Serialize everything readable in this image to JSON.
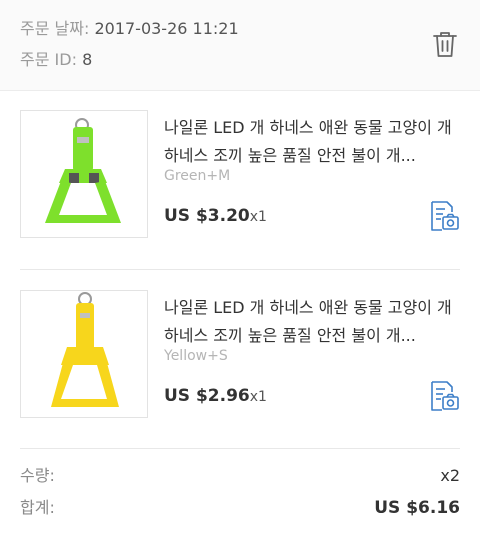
{
  "order": {
    "date_label": "주문 날짜:",
    "date_value": "2017-03-26 11:21",
    "id_label": "주문 ID:",
    "id_value": "8"
  },
  "items": [
    {
      "title": "나일론 LED 개 하네스 애완 동물 고양이 개 하네스 조끼 높은 품질 안전 불이 개...",
      "variant": "Green+M",
      "price": "US $3.20",
      "qty": "x1",
      "color": "#7ee02c"
    },
    {
      "title": "나일론 LED 개 하네스 애완 동물 고양이 개 하네스 조끼 높은 품질 안전 불이 개...",
      "variant": "Yellow+S",
      "price": "US $2.96",
      "qty": "x1",
      "color": "#f7d61c"
    }
  ],
  "summary": {
    "quantity_label": "수량:",
    "quantity_value": "x2",
    "total_label": "합계:",
    "total_value": "US $6.16"
  },
  "icons": {
    "delete": "trash-icon",
    "review": "photo-review-icon"
  },
  "colors": {
    "accent": "#3d7fc8",
    "label_gray": "#9a9a9a"
  }
}
